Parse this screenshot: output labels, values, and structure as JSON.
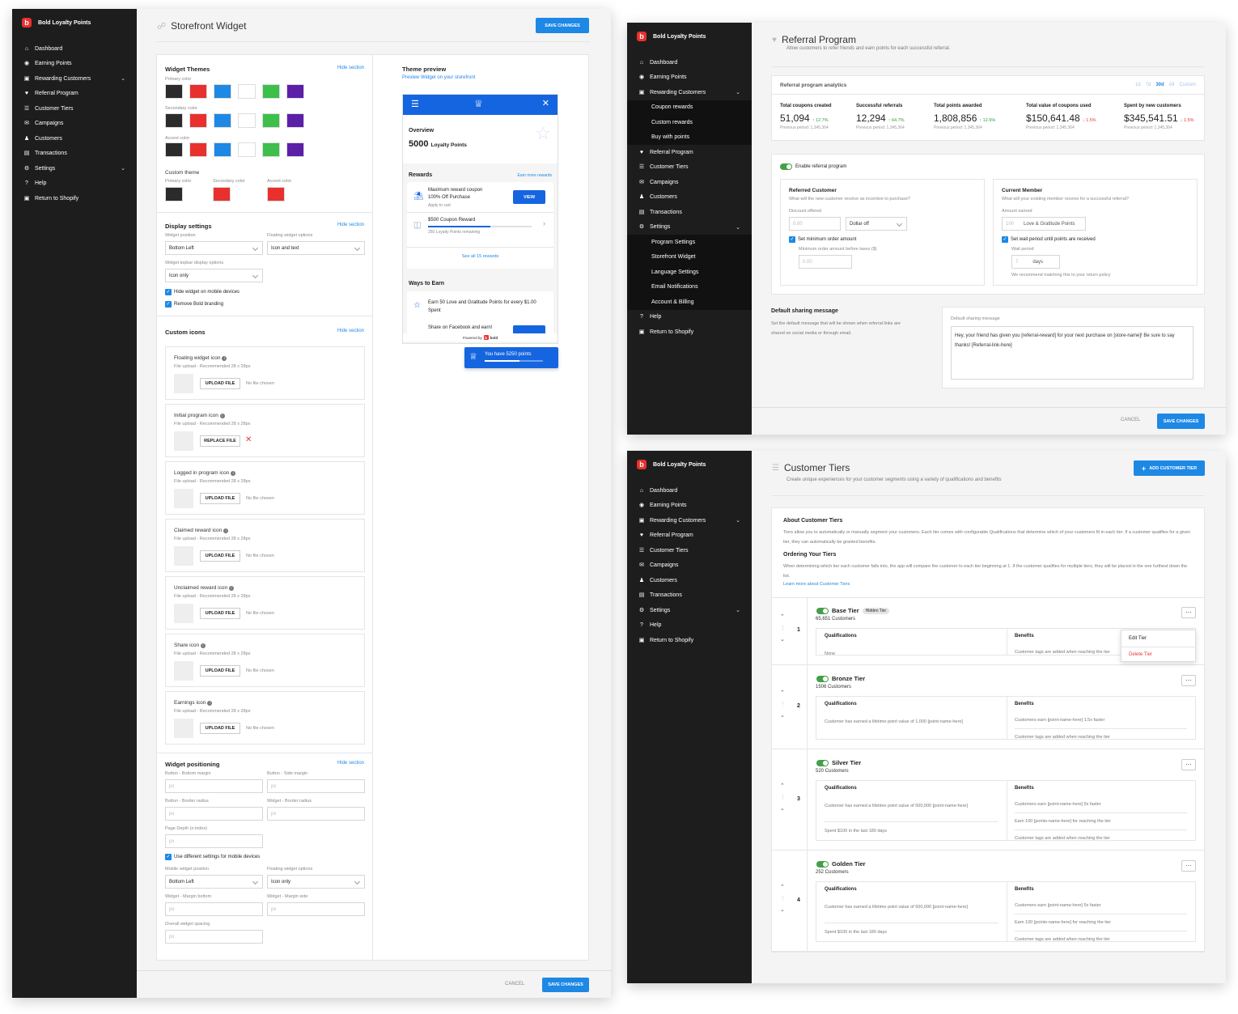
{
  "brand": "Bold Loyalty Points",
  "w1": {
    "nav": [
      "Dashboard",
      "Earning Points",
      "Rewarding Customers",
      "Referral Program",
      "Customer Tiers",
      "Campaigns",
      "Customers",
      "Transactions",
      "Settings",
      "Help",
      "Return to Shopify"
    ],
    "title": "Storefront Widget",
    "save": "SAVE CHANGES",
    "cancel": "CANCEL",
    "themes": {
      "h": "Widget Themes",
      "hide": "Hide section",
      "primary": "Primary color",
      "secondary": "Secondary color",
      "accent": "Accent color",
      "custom": "Custom theme",
      "c1": "Primary color",
      "c2": "Secondary color",
      "c3": "Accent color"
    },
    "swatches": [
      "#2b2b2b",
      "#e8312d",
      "#1e88e5",
      "#ffffff",
      "#3dbf4a",
      "#5b1fa8"
    ],
    "display": {
      "h": "Display settings",
      "hide": "Hide section",
      "pos_l": "Widget position",
      "pos_v": "Bottom Left",
      "float_l": "Floating widget options",
      "float_v": "Icon and text",
      "top_l": "Widget topbar display options",
      "top_v": "Icon only",
      "c1": "Hide widget on mobile devices",
      "c2": "Remove Bold branding"
    },
    "icons": {
      "h": "Custom icons",
      "hide": "Hide section",
      "items": [
        {
          "t": "Floating widget icon",
          "s": "File upload - Recommended 28 x 28px",
          "b": "UPLOAD FILE",
          "n": "No file chosen"
        },
        {
          "t": "Initial program icon",
          "s": "File upload - Recommended 28 x 28px",
          "b": "REPLACE FILE",
          "n": ""
        },
        {
          "t": "Logged in program icon",
          "s": "File upload - Recommended 28 x 28px",
          "b": "UPLOAD FILE",
          "n": "No file chosen"
        },
        {
          "t": "Claimed reward icon",
          "s": "File upload - Recommended 28 x 28px",
          "b": "UPLOAD FILE",
          "n": "No file chosen"
        },
        {
          "t": "Unclaimed reward icon",
          "s": "File upload - Recommended 28 x 28px",
          "b": "UPLOAD FILE",
          "n": "No file chosen"
        },
        {
          "t": "Share icon",
          "s": "File upload - Recommended 28 x 28px",
          "b": "UPLOAD FILE",
          "n": "No file chosen"
        },
        {
          "t": "Earnings icon",
          "s": "File upload - Recommended 28 x 28px",
          "b": "UPLOAD FILE",
          "n": "No file chosen"
        }
      ]
    },
    "positioning": {
      "h": "Widget positioning",
      "hide": "Hide section",
      "bb": "Button - Bottom margin",
      "bs": "Button - Side margin",
      "br": "Button - Border radius",
      "wr": "Widget - Border radius",
      "pd": "Page Depth (z-index)",
      "px": "px",
      "diff": "Use different settings for mobile devices",
      "mpos": "Mobile widget position",
      "mpos_v": "Bottom Left",
      "mfl": "Floating widget options",
      "mfl_v": "Icon only",
      "mb": "Widget - Margin bottom",
      "ms": "Widget - Margin side",
      "ows": "Overall widget spacing"
    },
    "preview": {
      "h": "Theme preview",
      "link": "Preview Widget on your storefront",
      "ov": "Overview",
      "pts": "5000",
      "ptsl": "Loyalty Points",
      "rewards": "Rewards",
      "earnmore": "Earn more rewards",
      "r1a": "Maximum reward coupon",
      "r1b": "100% Off Purchase",
      "r1c": "Apply to cart",
      "view": "VIEW",
      "r2a": "$500 Coupon Reward",
      "r2b": "250 Loyalty Points remaining",
      "seeall": "See all 15 rewards",
      "ways": "Ways to Earn",
      "w1": "Earn 50 Love and Gratitude Points for every $1.00 Spent",
      "w2": "Share on Facebook and earn!",
      "powered": "Powered by",
      "bold": "bold",
      "float": "You have 5250 points",
      "progress": 0.6
    }
  },
  "w2": {
    "nav": [
      "Dashboard",
      "Earning Points",
      "Rewarding Customers",
      "Coupon rewards",
      "Custom rewards",
      "Buy with points",
      "Referral Program",
      "Customer Tiers",
      "Campaigns",
      "Customers",
      "Transactions",
      "Settings",
      "Program Settings",
      "Storefront Widget",
      "Language Settings",
      "Email Notifications",
      "Account & Billing",
      "Help",
      "Return to Shopify"
    ],
    "title": "Referral Program",
    "desc": "Allow customers to refer friends and earn points for each successful referral.",
    "analytics": "Referral program analytics",
    "ranges": [
      "1d",
      "7d",
      "30d",
      "All",
      "Custom"
    ],
    "stats": [
      {
        "l": "Total coupons created",
        "v": "51,094",
        "d": "↑ 12.7%",
        "p": "Previous period: 1,345,364",
        "neg": false
      },
      {
        "l": "Successful referrals",
        "v": "12,294",
        "d": "↑ 64.7%",
        "p": "Previous period: 1,345,364",
        "neg": false
      },
      {
        "l": "Total points awarded",
        "v": "1,808,856",
        "d": "↑ 12.6%",
        "p": "Previous period: 1,345,364",
        "neg": false
      },
      {
        "l": "Total value of coupons used",
        "v": "$150,641.48",
        "d": "↓ 1.5%",
        "p": "Previous period: 1,345,364",
        "neg": true
      },
      {
        "l": "Spent by new customers",
        "v": "$345,541.51",
        "d": "↓ 1.5%",
        "p": "Previous period: 1,345,364",
        "neg": true
      }
    ],
    "enable": "Enable referral program",
    "ref": {
      "h": "Referred Customer",
      "q": "What will the new customer receive as incentive to purchase?",
      "dl": "Discount offered",
      "dv": "0.00",
      "dt": "Dollar off",
      "min": "Set minimum order amount",
      "minl": "Minimum order amount before taxes ($)",
      "minv": "0.00"
    },
    "cur": {
      "h": "Current Member",
      "q": "What will your existing member receive for a successful referral?",
      "al": "Amount earned",
      "av": "100",
      "at": "Love & Gratitude Points",
      "wait": "Set wait period until points are received",
      "wl": "Wait period",
      "wv": "7",
      "wu": "days",
      "rec": "We recommend matching this to your return policy"
    },
    "share": {
      "h": "Default sharing message",
      "d": "Set the default message that will be shown when referral links are shared on social media or through email.",
      "l": "Default sharing message",
      "v": "Hey, your friend has given you [referral-reward] for your next purchase on [store-name]! Be sure to say thanks! [Referral-link-here]"
    },
    "cancel": "CANCEL",
    "save": "SAVE CHANGES"
  },
  "w3": {
    "nav": [
      "Dashboard",
      "Earning Points",
      "Rewarding Customers",
      "Referral Program",
      "Customer Tiers",
      "Campaigns",
      "Customers",
      "Transactions",
      "Settings",
      "Help",
      "Return to Shopify"
    ],
    "title": "Customer Tiers",
    "desc": "Create unique experiences for your customer segments using a variety of qualifications and benefits",
    "add": "ADD CUSTOMER TIER",
    "about_h": "About Customer Tiers",
    "about": "Tiers allow you to automatically or manually segment your customers. Each tier comes with configurable Qualifications that determine which of your customers fit in each tier. If a customer qualifies for a given tier, they can automatically be granted benefits.",
    "order_h": "Ordering Your Tiers",
    "order": "When determining which tier each customer falls into, the app will compare the customer to each tier beginning at 1. If the customer qualifies for multiple tiers, they will be placed in the one furthest down the list.",
    "learn": "Learn more about Customer Tiers",
    "qh": "Qualifications",
    "bh": "Benefits",
    "hidden": "Hidden Tier",
    "edit": "Edit Tier",
    "del": "Delete Tier",
    "tiers": [
      {
        "n": "1",
        "name": "Base Tier",
        "count": "65,651 Customers",
        "q": [
          "None"
        ],
        "b": [
          "Customer tags are added when reaching the tier"
        ]
      },
      {
        "n": "2",
        "name": "Bronze Tier",
        "count": "1506 Customers",
        "q": [
          "Customer has earned a lifetime point value of 1,000 [point-name-here]"
        ],
        "b": [
          "Customers earn [point-name-here] 1.5x faster",
          "Customer tags are added when reaching the tier"
        ]
      },
      {
        "n": "3",
        "name": "Silver Tier",
        "count": "520 Customers",
        "q": [
          "Customer has earned a lifetime point value of 500,000 [point-name-here]",
          "Spent $100 in the last 180 days"
        ],
        "b": [
          "Customers earn [point-name-here] 5x faster",
          "Earn 100 [points-name-here] for reaching the tier",
          "Customer tags are added when reaching the tier"
        ]
      },
      {
        "n": "4",
        "name": "Golden Tier",
        "count": "252 Customers",
        "q": [
          "Customer has earned a lifetime point value of 500,000 [point-name-here]",
          "Spent $100 in the last 180 days"
        ],
        "b": [
          "Customers earn [point-name-here] 5x faster",
          "Earn 100 [points-name-here] for reaching the tier",
          "Customer tags are added when reaching the tier"
        ]
      }
    ]
  }
}
